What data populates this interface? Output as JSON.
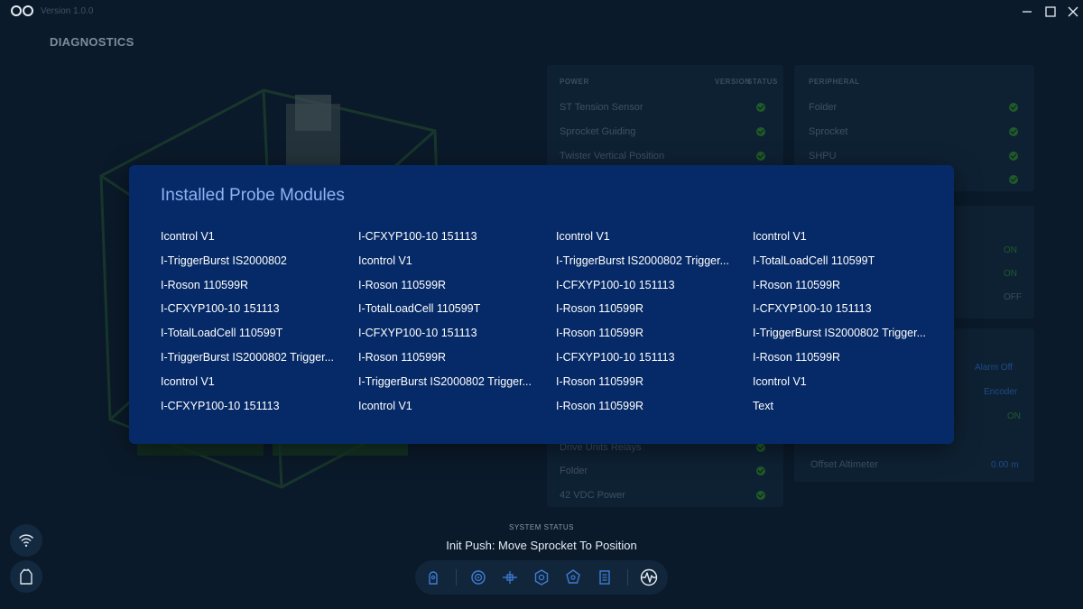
{
  "app": {
    "version": "Version 1.0.0",
    "page_title": "DIAGNOSTICS"
  },
  "background": {
    "power_panel": {
      "header": "POWER",
      "col_version": "VERSION",
      "col_status": "STATUS",
      "rows_top": [
        "ST Tension Sensor",
        "Sprocket Guiding",
        "Twister Vertical Position"
      ],
      "rows_bottom": [
        "Drive Units Relays",
        "Folder",
        "42 VDC Power"
      ]
    },
    "peripheral_panel": {
      "header": "PERIPHERAL",
      "rows": [
        "Folder",
        "Sprocket",
        "SHPU"
      ]
    },
    "right_values": [
      "ON",
      "ON",
      "OFF"
    ],
    "right3": {
      "values": [
        "Alarm Off",
        "Encoder",
        "ON"
      ],
      "last_row_label": "Offset Altimeter",
      "last_row_value": "0.00 m"
    }
  },
  "modal": {
    "title": "Installed Probe Modules",
    "columns": [
      [
        "Icontrol V1",
        "I-TriggerBurst IS2000802",
        "I-Roson 110599R",
        "I-CFXYP100-10 151113",
        "I-TotalLoadCell 110599T",
        "I-TriggerBurst IS2000802 Trigger...",
        "Icontrol V1",
        "I-CFXYP100-10 151113"
      ],
      [
        "I-CFXYP100-10 151113",
        "Icontrol V1",
        "I-Roson 110599R",
        "I-TotalLoadCell 110599T",
        "I-CFXYP100-10 151113",
        "I-Roson 110599R",
        "I-TriggerBurst IS2000802 Trigger...",
        "Icontrol V1"
      ],
      [
        "Icontrol V1",
        "I-TriggerBurst IS2000802 Trigger...",
        "I-CFXYP100-10 151113",
        "I-Roson 110599R",
        "I-Roson 110599R",
        "I-CFXYP100-10 151113",
        "I-Roson 110599R",
        "I-Roson 110599R"
      ],
      [
        "Icontrol V1",
        "I-TotalLoadCell 110599T",
        "I-Roson 110599R",
        "I-CFXYP100-10 151113",
        "I-TriggerBurst IS2000802 Trigger...",
        "I-Roson 110599R",
        "Icontrol V1",
        "Text"
      ]
    ]
  },
  "system_status": {
    "label": "SYSTEM STATUS",
    "text": "Init Push: Move Sprocket To Position"
  },
  "bottom_nav": {
    "items": [
      "probe-icon",
      "target-icon",
      "drone-icon",
      "gear-icon",
      "network-icon",
      "document-icon",
      "waveform-icon"
    ],
    "active": "waveform-icon"
  },
  "colors": {
    "background": "#0b1a2a",
    "modal": "#062a67",
    "modal_title": "#8fb3f2",
    "ok_green": "#1f5a2c",
    "accent": "#3d7dd8"
  }
}
